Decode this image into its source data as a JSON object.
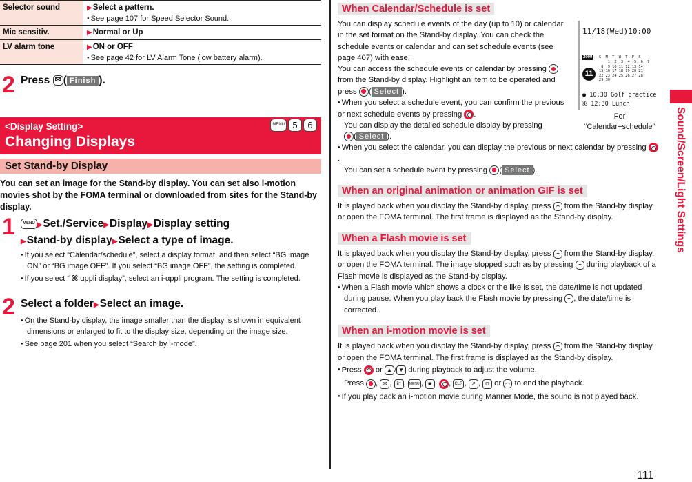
{
  "settings_table": {
    "rows": [
      {
        "label": "Selector sound",
        "value": "Select a pattern.",
        "note": "See page 107 for Speed Selector Sound."
      },
      {
        "label": "Mic sensitiv.",
        "value": "Normal or Up",
        "note": ""
      },
      {
        "label": "LV alarm tone",
        "value": "ON or OFF",
        "note": "See page 42 for LV Alarm Tone (low battery alarm)."
      }
    ]
  },
  "step_top": {
    "number": "2",
    "press": "Press",
    "key_icon": "mail-key",
    "softkey": "Finish",
    "close": ")."
  },
  "section": {
    "subtitle": "<Display Setting>",
    "title": "Changing Displays",
    "menu_keys": [
      "MENU",
      "5",
      "6"
    ],
    "subheading": "Set Stand-by Display",
    "intro": "You can set an image for the Stand-by display. You can set also i-motion movies shot by the FOMA terminal or downloaded from sites for the Stand-by display."
  },
  "step1": {
    "number": "1",
    "menu_key": "MENU",
    "path": [
      "Set./Service",
      "Display",
      "Display setting",
      "Stand-by display",
      "Select a type of image."
    ],
    "bullets": [
      "If you select “Calendar/schedule”, select a display format, and then select “BG image ON” or “BG image OFF”. If you select “BG image OFF”, the setting is completed.",
      "If you select “ ꕤ αppli display”, select an i-αppli program. The setting is completed."
    ]
  },
  "step2": {
    "number": "2",
    "path": [
      "Select a folder",
      "Select an image."
    ],
    "bullets": [
      "On the Stand-by display, the image smaller than the display is shown in equivalent dimensions or enlarged to fit to the display size, depending on the image size.",
      "See page 201 when you select “Search by i-mode”."
    ]
  },
  "right": {
    "calendar": {
      "heading": "When Calendar/Schedule is set",
      "p1": "You can display schedule events of the day (up to 10) or calendar in the set format on the Stand-by display. You can check the schedule events or calendar and can set schedule events (see page 407) with ease.",
      "p2a": "You can access the schedule events or calendar by pressing",
      "p2b": "from the Stand-by display. Highlight an item to be operated and press",
      "select": "Select",
      "b1a": "When you select a schedule event, you can confirm the previous or next schedule events by pressing",
      "b1b": "You can display the detailed schedule display by pressing",
      "b2a": "When you select the calendar, you can display the previous or next calendar by pressing",
      "b2b": "You can set a schedule event by pressing"
    },
    "phone_screen": {
      "datetime": "11/18(Wed)10:00",
      "year": "2009",
      "weekdays": "S  M  T  W  T  F  S",
      "day": "11",
      "events": [
        "● 10:30 Golf practice",
        "ꕤ 12:30 Lunch"
      ],
      "caption_line1": "For",
      "caption_line2": "“Calendar+schedule”"
    },
    "animation": {
      "heading": "When an original animation or animation GIF is set",
      "p1a": "It is played back when you display the Stand-by display, press",
      "p1b": "from the Stand-by display, or open the FOMA terminal. The first frame is displayed as the Stand-by display."
    },
    "flash": {
      "heading": "When a Flash movie is set",
      "p1a": "It is played back when you display the Stand-by display, press",
      "p1b": "from the Stand-by display, or open the FOMA terminal. The image stopped such as by pressing",
      "p1c": "during playback of a Flash movie is displayed as the Stand-by display.",
      "b1a": "When a Flash movie which shows a clock or the like is set, the date/time is not updated during pause. When you play back the Flash movie by pressing",
      "b1b": ", the date/time is corrected."
    },
    "imotion": {
      "heading": "When an i-motion movie is set",
      "p1a": "It is played back when you display the Stand-by display, press",
      "p1b": "from the Stand-by display, or open the FOMA terminal. The first frame is displayed as the Stand-by display.",
      "b1a": "Press",
      "b1b": "or",
      "b1c": "during playback to adjust the volume.",
      "b1d": "Press",
      "b1e": "to end the playback.",
      "b1_or": "or",
      "b2": "If you play back an i-motion movie during Manner Mode, the sound is not played back."
    }
  },
  "side_tab": {
    "label": "Sound/Screen/Light Settings",
    "color": "#e8173c"
  },
  "page_number": "111"
}
